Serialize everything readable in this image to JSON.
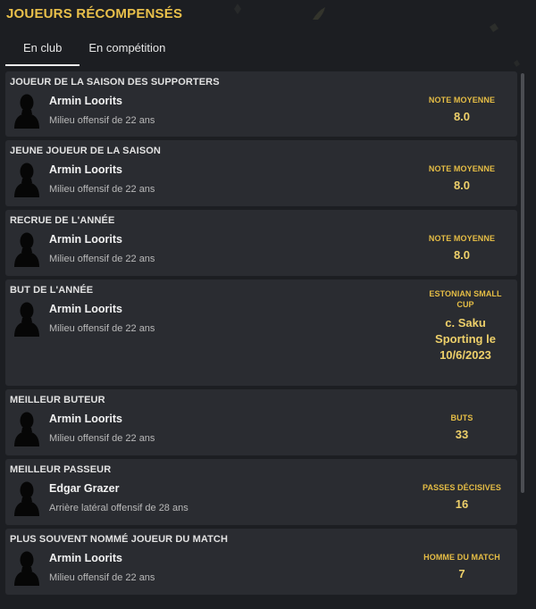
{
  "header": {
    "title": "JOUEURS RÉCOMPENSÉS",
    "tabs": [
      {
        "label": "En club",
        "active": true
      },
      {
        "label": "En compétition",
        "active": false
      }
    ]
  },
  "awards": [
    {
      "title": "JOUEUR DE LA SAISON DES SUPPORTERS",
      "player": "Armin Loorits",
      "desc": "Milieu offensif de 22 ans",
      "stat_label": "NOTE MOYENNE",
      "stat_value": "8.0"
    },
    {
      "title": "JEUNE JOUEUR DE LA SAISON",
      "player": "Armin Loorits",
      "desc": "Milieu offensif de 22 ans",
      "stat_label": "NOTE MOYENNE",
      "stat_value": "8.0"
    },
    {
      "title": "RECRUE DE L'ANNÉE",
      "player": "Armin Loorits",
      "desc": "Milieu offensif de 22 ans",
      "stat_label": "NOTE MOYENNE",
      "stat_value": "8.0"
    },
    {
      "title": "BUT DE L'ANNÉE",
      "player": "Armin Loorits",
      "desc": "Milieu offensif de 22 ans",
      "stat_label": "ESTONIAN SMALL CUP",
      "stat_value": "c. Saku Sporting le 10/6/2023"
    },
    {
      "title": "MEILLEUR BUTEUR",
      "player": "Armin Loorits",
      "desc": "Milieu offensif de 22 ans",
      "stat_label": "BUTS",
      "stat_value": "33"
    },
    {
      "title": "MEILLEUR PASSEUR",
      "player": "Edgar Grazer",
      "desc": "Arrière latéral offensif de 28 ans",
      "stat_label": "PASSES DÉCISIVES",
      "stat_value": "16"
    },
    {
      "title": "PLUS SOUVENT NOMMÉ JOUEUR DU MATCH",
      "player": "Armin Loorits",
      "desc": "Milieu offensif de 22 ans",
      "stat_label": "HOMME DU MATCH",
      "stat_value": "7"
    }
  ],
  "colors": {
    "accent": "#e9c04a",
    "card": "#2a2c31",
    "background": "#1c1e22"
  }
}
